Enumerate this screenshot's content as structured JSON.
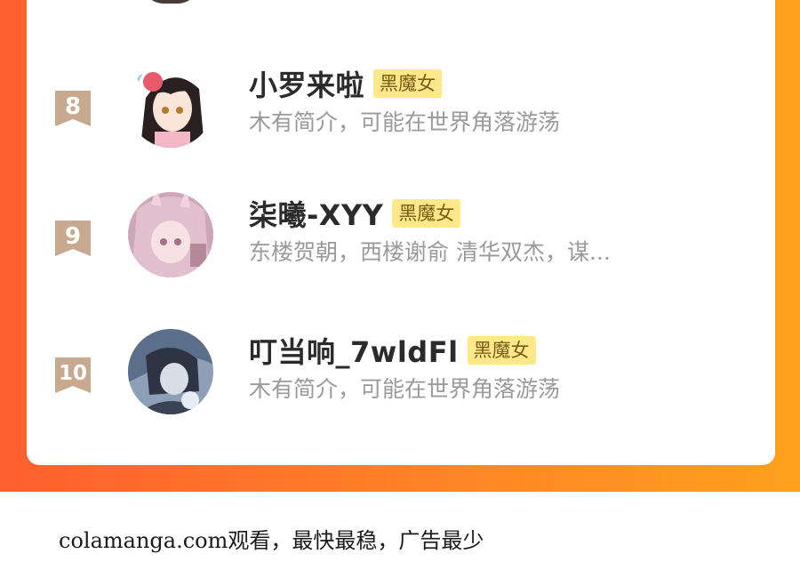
{
  "list": {
    "badge_color": "#fde98a",
    "accent_gradient": [
      "#ff5f2e",
      "#ffa11d"
    ],
    "entries": [
      {
        "rank": "8",
        "name": "小罗来啦",
        "badge": "黑魔女",
        "description": "木有简介，可能在世界角落游荡"
      },
      {
        "rank": "9",
        "name": "柒曦-XYY",
        "badge": "黑魔女",
        "description": "东楼贺朝，西楼谢俞 清华双杰，谋..."
      },
      {
        "rank": "10",
        "name": "叮当响_7wldFl",
        "badge": "黑魔女",
        "description": "木有简介，可能在世界角落游荡"
      }
    ]
  },
  "footer": {
    "text": "colamanga.com观看，最快最稳，广告最少"
  }
}
